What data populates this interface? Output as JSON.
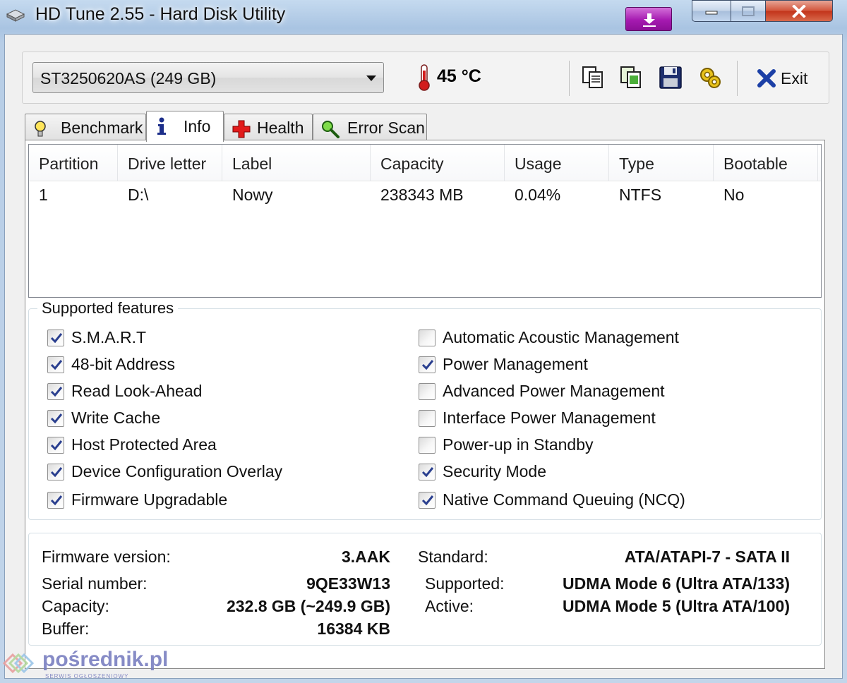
{
  "window": {
    "title": "HD Tune 2.55 - Hard Disk Utility"
  },
  "toolbar": {
    "drive": "ST3250620AS (249 GB)",
    "temperature": "45 °C",
    "exit_label": "Exit"
  },
  "tabs": [
    {
      "label": "Benchmark",
      "icon": "benchmark-icon"
    },
    {
      "label": "Info",
      "icon": "info-icon",
      "active": true
    },
    {
      "label": "Health",
      "icon": "health-icon"
    },
    {
      "label": "Error Scan",
      "icon": "magnifier-icon"
    }
  ],
  "partitions": {
    "columns": [
      "Partition",
      "Drive letter",
      "Label",
      "Capacity",
      "Usage",
      "Type",
      "Bootable"
    ],
    "rows": [
      [
        "1",
        "D:\\",
        "Nowy",
        "238343 MB",
        "0.04%",
        "NTFS",
        "No"
      ]
    ]
  },
  "features": {
    "legend": "Supported features",
    "left": [
      {
        "label": "S.M.A.R.T",
        "checked": true
      },
      {
        "label": "48-bit Address",
        "checked": true
      },
      {
        "label": "Read Look-Ahead",
        "checked": true
      },
      {
        "label": "Write Cache",
        "checked": true
      },
      {
        "label": "Host Protected Area",
        "checked": true
      },
      {
        "label": "Device Configuration Overlay",
        "checked": true
      },
      {
        "label": "Firmware Upgradable",
        "checked": true
      }
    ],
    "right": [
      {
        "label": "Automatic Acoustic Management",
        "checked": false
      },
      {
        "label": "Power Management",
        "checked": true
      },
      {
        "label": "Advanced Power Management",
        "checked": false
      },
      {
        "label": "Interface Power Management",
        "checked": false
      },
      {
        "label": "Power-up in Standby",
        "checked": false
      },
      {
        "label": "Security Mode",
        "checked": true
      },
      {
        "label": "Native Command Queuing (NCQ)",
        "checked": true
      }
    ]
  },
  "drive_info": {
    "firmware_label": "Firmware version:",
    "firmware": "3.AAK",
    "serial_label": "Serial number:",
    "serial": "9QE33W13",
    "capacity_label": "Capacity:",
    "capacity": "232.8 GB (~249.9 GB)",
    "buffer_label": "Buffer:",
    "buffer": "16384 KB",
    "standard_label": "Standard:",
    "standard": "ATA/ATAPI-7 - SATA II",
    "supported_label": "Supported:",
    "supported": "UDMA Mode 6 (Ultra ATA/133)",
    "active_label": "Active:",
    "active": "UDMA Mode 5 (Ultra ATA/100)"
  },
  "watermark": {
    "text": "pośrednik.pl",
    "sub": "SERWIS OGŁOSZENIOWY"
  }
}
